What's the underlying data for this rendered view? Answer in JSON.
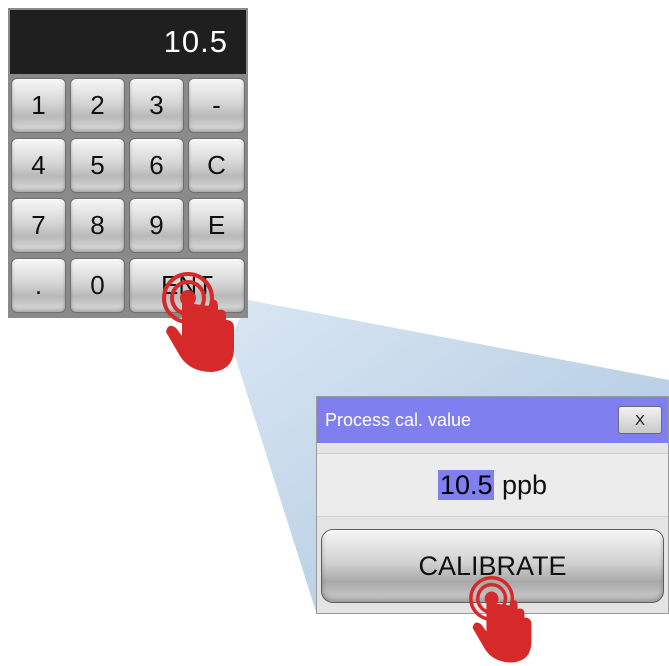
{
  "keypad": {
    "display_value": "10.5",
    "keys": {
      "k1": "1",
      "k2": "2",
      "k3": "3",
      "minus": "-",
      "k4": "4",
      "k5": "5",
      "k6": "6",
      "clear": "C",
      "k7": "7",
      "k8": "8",
      "k9": "9",
      "exp": "E",
      "dot": ".",
      "k0": "0",
      "enter": "ENT"
    }
  },
  "dialog": {
    "title": "Process cal. value",
    "close_label": "X",
    "value": "10.5",
    "unit": "ppb",
    "calibrate_label": "CALIBRATE"
  },
  "colors": {
    "accent": "#7f7ff0",
    "display_bg": "#1f1f1f",
    "tap_hand": "#d62a2a"
  },
  "icons": [
    "tap-hand-icon"
  ]
}
